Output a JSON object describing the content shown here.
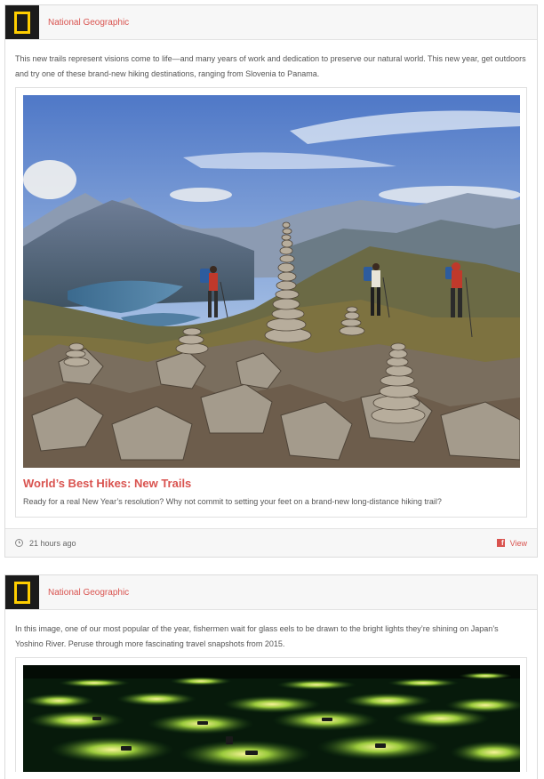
{
  "posts": [
    {
      "source": "National Geographic",
      "logo_icon": "national-geographic-logo-icon",
      "text": "This new trails represent visions come to life—and many years of work and dedication to preserve our natural world. This new year, get outdoors and try one of these brand-new hiking destinations, ranging from Slovenia to Panama.",
      "attachment": {
        "title": "World’s Best Hikes: New Trails",
        "description": "Ready for a real New Year’s resolution? Why not commit to setting your feet on a brand-new long-distance hiking trail?"
      },
      "time": "21 hours ago",
      "view_label": "View"
    },
    {
      "source": "National Geographic",
      "logo_icon": "national-geographic-logo-icon",
      "text": "In this image, one of our most popular of the year, fishermen wait for glass eels to be drawn to the bright lights they’re shining on Japan’s Yoshino River. Peruse through more fascinating travel snapshots from 2015."
    }
  ],
  "colors": {
    "accent": "#d9534f",
    "logo_yellow": "#ffce00",
    "logo_bg": "#1b1b1b"
  }
}
